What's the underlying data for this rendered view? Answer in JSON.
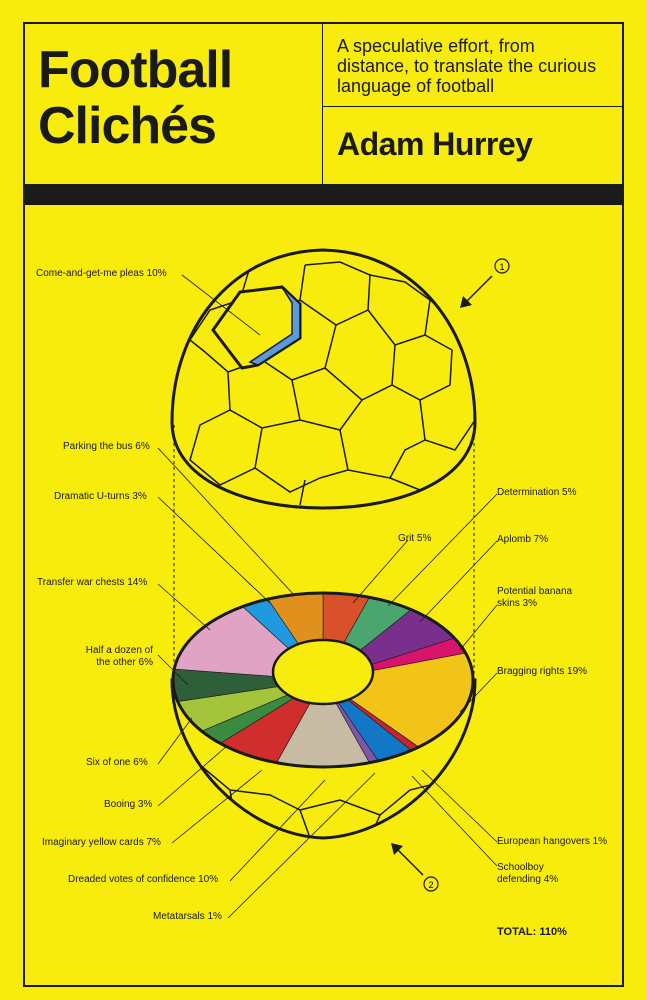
{
  "cover": {
    "title_line1": "Football",
    "title_line2": "Clichés",
    "subtitle": "A speculative effort, from distance, to translate the curious language of football",
    "author": "Adam Hurrey",
    "total": "TOTAL: 110%",
    "marker1": "1",
    "marker2": "2",
    "background_color": "#f8ec0c"
  },
  "labels": {
    "come_and_get_me": "Come-and-get-me pleas 10%",
    "parking_bus": "Parking the bus 6%",
    "dramatic_uturns": "Dramatic U-turns 3%",
    "transfer_war": "Transfer war chests 14%",
    "half_dozen_1": "Half a dozen of",
    "half_dozen_2": "the other 6%",
    "six_of_one": "Six of one 6%",
    "booing": "Booing 3%",
    "imaginary_yellow": "Imaginary yellow cards 7%",
    "dreaded_votes": "Dreaded votes of confidence 10%",
    "metatarsals": "Metatarsals 1%",
    "grit": "Grit 5%",
    "determination": "Determination 5%",
    "aplomb": "Aplomb 7%",
    "banana_1": "Potential banana",
    "banana_2": "skins 3%",
    "bragging": "Bragging rights 19%",
    "european": "European hangovers 1%",
    "schoolboy_1": "Schoolboy",
    "schoolboy_2": "defending 4%"
  },
  "chart_data": {
    "type": "pie",
    "total": "TOTAL: 110%",
    "slices": [
      {
        "label": "Grit",
        "value": 5,
        "color": "#d9512b"
      },
      {
        "label": "Determination",
        "value": 5,
        "color": "#4aa56f"
      },
      {
        "label": "Aplomb",
        "value": 7,
        "color": "#7b2f8c"
      },
      {
        "label": "Potential banana skins",
        "value": 3,
        "color": "#d8136b"
      },
      {
        "label": "Bragging rights",
        "value": 19,
        "color": "#f2c418"
      },
      {
        "label": "European hangovers",
        "value": 1,
        "color": "#c7242f"
      },
      {
        "label": "Schoolboy defending",
        "value": 4,
        "color": "#1277c6"
      },
      {
        "label": "Metatarsals",
        "value": 1,
        "color": "#7e58a6"
      },
      {
        "label": "Dreaded votes of confidence",
        "value": 10,
        "color": "#c8bba4"
      },
      {
        "label": "Imaginary yellow cards",
        "value": 7,
        "color": "#cf2e2c"
      },
      {
        "label": "Booing",
        "value": 3,
        "color": "#3a8a3f"
      },
      {
        "label": "Six of one",
        "value": 6,
        "color": "#a4c43b"
      },
      {
        "label": "Half a dozen of the other",
        "value": 6,
        "color": "#2f5f38"
      },
      {
        "label": "Transfer war chests",
        "value": 14,
        "color": "#e0a3c3"
      },
      {
        "label": "Dramatic U-turns",
        "value": 3,
        "color": "#1f9ae0"
      },
      {
        "label": "Parking the bus",
        "value": 6,
        "color": "#e0901c"
      }
    ],
    "highlight": {
      "label": "Come-and-get-me pleas",
      "value": 10,
      "color": "#5a9bdd"
    }
  }
}
